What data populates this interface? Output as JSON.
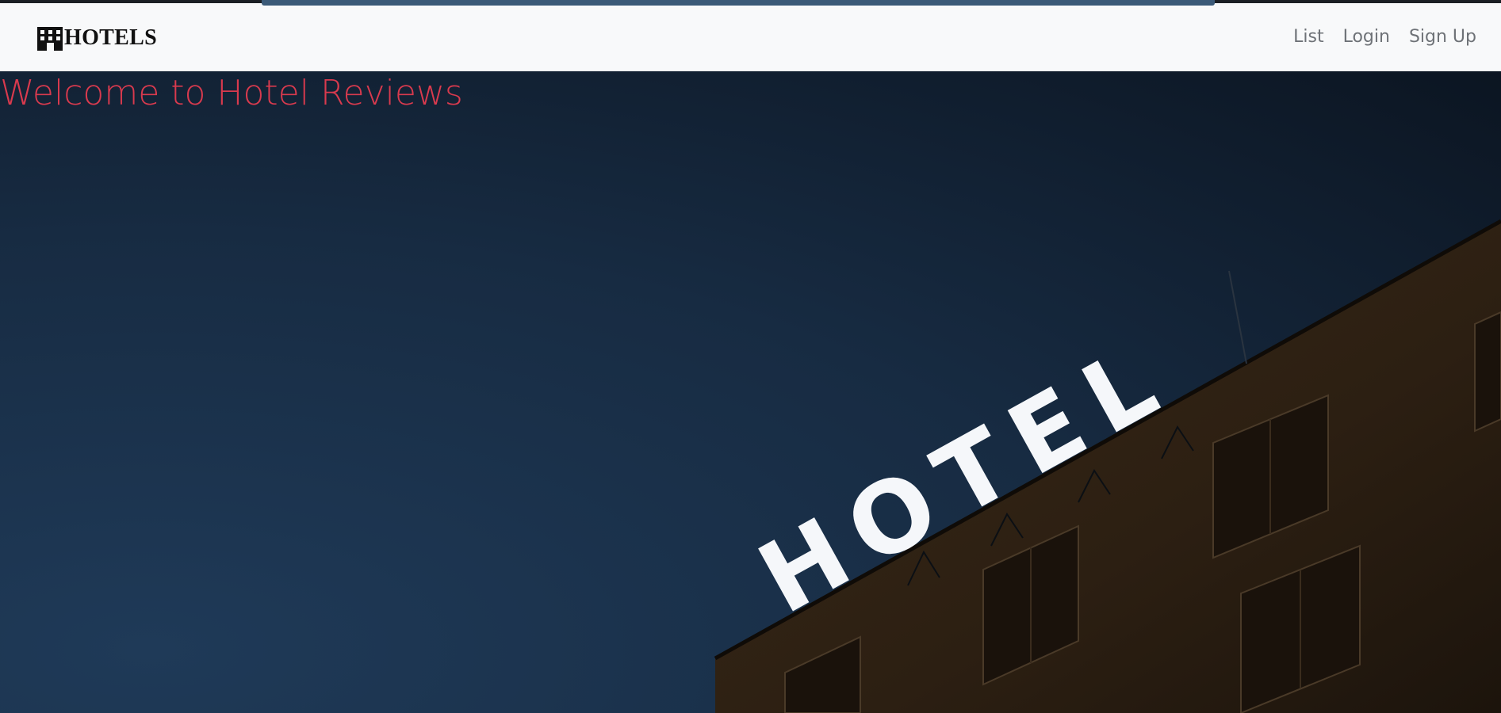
{
  "navbar": {
    "brand": "HOTELS",
    "links": [
      "List",
      "Login",
      "Sign Up"
    ]
  },
  "hero": {
    "title": "Welcome to Hotel Reviews",
    "sign_text": "HOTEL"
  },
  "colors": {
    "navbar_bg": "#f8f9fa",
    "title": "#d93a4e",
    "sky": "#142438",
    "building": "#2b1f14"
  },
  "icons": {
    "brand": "hotel-building-icon"
  }
}
